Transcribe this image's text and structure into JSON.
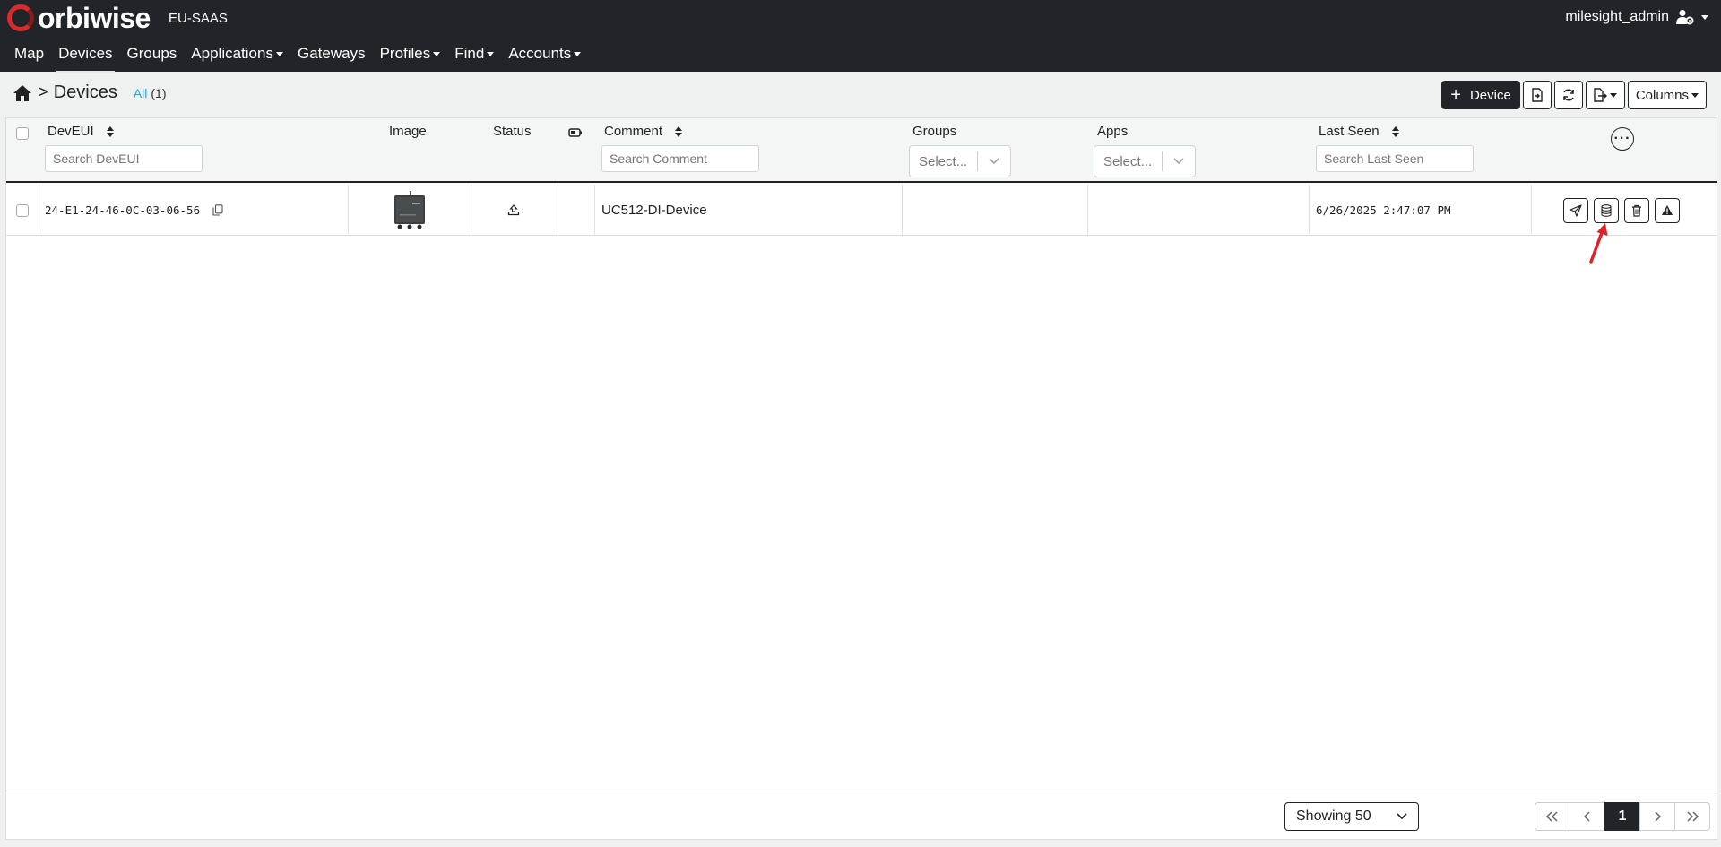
{
  "app": {
    "brand": "orbiwise",
    "tenant": "EU-SAAS",
    "user": "milesight_admin"
  },
  "nav": [
    {
      "label": "Map",
      "dropdown": false,
      "active": false
    },
    {
      "label": "Devices",
      "dropdown": false,
      "active": true
    },
    {
      "label": "Groups",
      "dropdown": false,
      "active": false
    },
    {
      "label": "Applications",
      "dropdown": true,
      "active": false
    },
    {
      "label": "Gateways",
      "dropdown": false,
      "active": false
    },
    {
      "label": "Profiles",
      "dropdown": true,
      "active": false
    },
    {
      "label": "Find",
      "dropdown": true,
      "active": false
    },
    {
      "label": "Accounts",
      "dropdown": true,
      "active": false
    }
  ],
  "breadcrumb": {
    "separator": ">",
    "title": "Devices",
    "filter": "All",
    "count": "(1)"
  },
  "toolbar": {
    "add_device": "Device",
    "columns": "Columns"
  },
  "table": {
    "headers": {
      "deveui": "DevEUI",
      "image": "Image",
      "status": "Status",
      "comment": "Comment",
      "groups": "Groups",
      "apps": "Apps",
      "last_seen": "Last Seen"
    },
    "placeholders": {
      "deveui": "Search DevEUI",
      "comment": "Search Comment",
      "groups": "Select...",
      "apps": "Select...",
      "last_seen": "Search Last Seen"
    },
    "rows": [
      {
        "deveui": "24-E1-24-46-0C-03-06-56",
        "comment": "UC512-DI-Device",
        "groups": "",
        "apps": "",
        "last_seen": "6/26/2025 2:47:07 PM"
      }
    ]
  },
  "footer": {
    "showing": "Showing 50",
    "page": "1"
  },
  "colors": {
    "topbar": "#212529",
    "accent": "#d92b2b",
    "link": "#2f9fd8",
    "annotation_arrow": "#e0202a"
  }
}
